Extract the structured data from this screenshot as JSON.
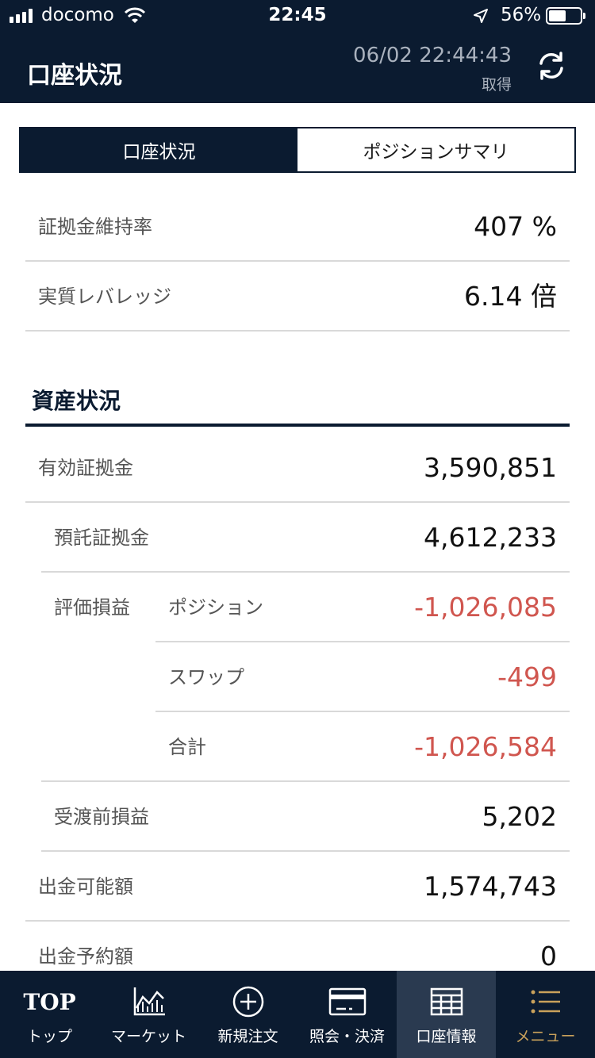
{
  "status": {
    "carrier": "docomo",
    "time": "22:45",
    "battery": "56%"
  },
  "header": {
    "title": "口座状況",
    "timestamp": "06/02 22:44:43",
    "timestamp_sub": "取得"
  },
  "segments": {
    "account": "口座状況",
    "position_summary": "ポジションサマリ"
  },
  "ratios": {
    "margin_rate_label": "証拠金維持率",
    "margin_rate_value": "407 %",
    "leverage_label": "実質レバレッジ",
    "leverage_value": "6.14 倍"
  },
  "assets": {
    "section_title": "資産状況",
    "effective_margin_label": "有効証拠金",
    "effective_margin_value": "3,590,851",
    "deposit_margin_label": "預託証拠金",
    "deposit_margin_value": "4,612,233",
    "eval_label": "評価損益",
    "position_label": "ポジション",
    "position_value": "-1,026,085",
    "swap_label": "スワップ",
    "swap_value": "-499",
    "total_label": "合計",
    "total_value": "-1,026,584",
    "pre_settle_label": "受渡前損益",
    "pre_settle_value": "5,202",
    "withdrawable_label": "出金可能額",
    "withdrawable_value": "1,574,743",
    "withdraw_reserved_label": "出金予約額",
    "withdraw_reserved_value": "0"
  },
  "tabbar": {
    "top_icon_text": "TOP",
    "top": "トップ",
    "market": "マーケット",
    "new_order": "新規注文",
    "inquiry": "照会・決済",
    "account_info": "口座情報",
    "menu": "メニュー"
  },
  "colors": {
    "navy": "#0b1b30",
    "negative": "#d0564f",
    "menu_gold": "#c9a15b"
  }
}
